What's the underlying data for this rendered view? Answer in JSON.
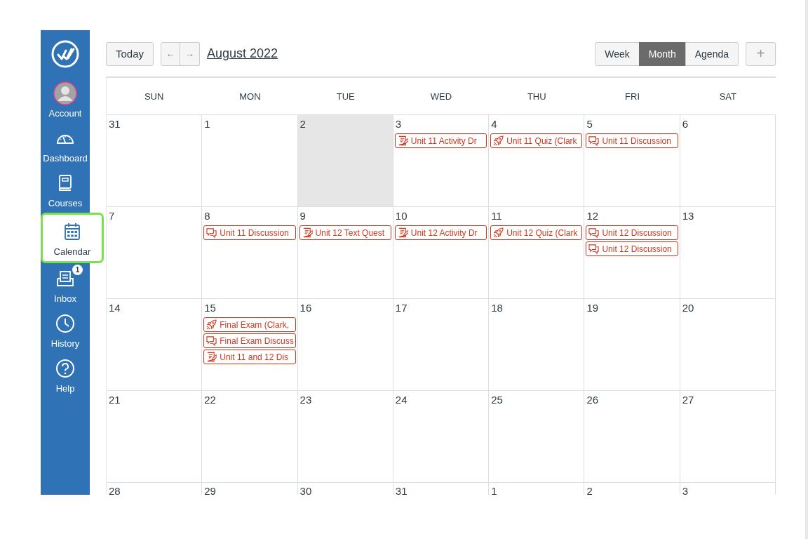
{
  "sidebar": {
    "items": [
      {
        "kind": "account",
        "label": "Account",
        "selected": false
      },
      {
        "kind": "dashboard",
        "label": "Dashboard",
        "selected": false
      },
      {
        "kind": "courses",
        "label": "Courses",
        "selected": false
      },
      {
        "kind": "calendar",
        "label": "Calendar",
        "selected": true
      },
      {
        "kind": "inbox",
        "label": "Inbox",
        "selected": false,
        "badge": "1"
      },
      {
        "kind": "history",
        "label": "History",
        "selected": false
      },
      {
        "kind": "help",
        "label": "Help",
        "selected": false
      }
    ]
  },
  "toolbar": {
    "today_button": "Today",
    "prev_button": "←",
    "next_button": "→",
    "month_title": "August 2022",
    "views": [
      {
        "label": "Week",
        "selected": false
      },
      {
        "label": "Month",
        "selected": true
      },
      {
        "label": "Agenda",
        "selected": false
      }
    ],
    "add_button": "+"
  },
  "calendar": {
    "weekdays": [
      "SUN",
      "MON",
      "TUE",
      "WED",
      "THU",
      "FRI",
      "SAT"
    ],
    "weeks": [
      [
        {
          "date": "31",
          "today": false
        },
        {
          "date": "1",
          "today": false
        },
        {
          "date": "2",
          "today": true
        },
        {
          "date": "3",
          "today": false,
          "events": [
            {
              "kind": "assignment",
              "title": "Unit 11 Activity Dr"
            }
          ]
        },
        {
          "date": "4",
          "today": false,
          "events": [
            {
              "kind": "quiz",
              "title": "Unit 11 Quiz (Clark"
            }
          ]
        },
        {
          "date": "5",
          "today": false,
          "events": [
            {
              "kind": "discussion",
              "title": "Unit 11 Discussion"
            }
          ]
        },
        {
          "date": "6",
          "today": false
        }
      ],
      [
        {
          "date": "7",
          "today": false
        },
        {
          "date": "8",
          "today": false,
          "events": [
            {
              "kind": "discussion",
              "title": "Unit 11 Discussion"
            }
          ]
        },
        {
          "date": "9",
          "today": false,
          "events": [
            {
              "kind": "assignment",
              "title": "Unit 12 Text Quest"
            }
          ]
        },
        {
          "date": "10",
          "today": false,
          "events": [
            {
              "kind": "assignment",
              "title": "Unit 12 Activity Dr"
            }
          ]
        },
        {
          "date": "11",
          "today": false,
          "events": [
            {
              "kind": "quiz",
              "title": "Unit 12 Quiz (Clark"
            }
          ]
        },
        {
          "date": "12",
          "today": false,
          "events": [
            {
              "kind": "discussion",
              "title": "Unit 12 Discussion"
            },
            {
              "kind": "discussion",
              "title": "Unit 12 Discussion"
            }
          ]
        },
        {
          "date": "13",
          "today": false
        }
      ],
      [
        {
          "date": "14",
          "today": false
        },
        {
          "date": "15",
          "today": false,
          "events": [
            {
              "kind": "quiz",
              "title": "Final Exam (Clark,"
            },
            {
              "kind": "discussion",
              "title": "Final Exam Discuss"
            },
            {
              "kind": "assignment",
              "title": "Unit 11 and 12 Dis"
            }
          ]
        },
        {
          "date": "16",
          "today": false
        },
        {
          "date": "17",
          "today": false
        },
        {
          "date": "18",
          "today": false
        },
        {
          "date": "19",
          "today": false
        },
        {
          "date": "20",
          "today": false
        }
      ],
      [
        {
          "date": "21",
          "today": false
        },
        {
          "date": "22",
          "today": false
        },
        {
          "date": "23",
          "today": false
        },
        {
          "date": "24",
          "today": false
        },
        {
          "date": "25",
          "today": false
        },
        {
          "date": "26",
          "today": false
        },
        {
          "date": "27",
          "today": false
        }
      ],
      [
        {
          "date": "28",
          "today": false
        },
        {
          "date": "29",
          "today": false
        },
        {
          "date": "30",
          "today": false
        },
        {
          "date": "31",
          "today": false
        },
        {
          "date": "1",
          "today": false
        },
        {
          "date": "2",
          "today": false
        },
        {
          "date": "3",
          "today": false
        }
      ]
    ]
  }
}
